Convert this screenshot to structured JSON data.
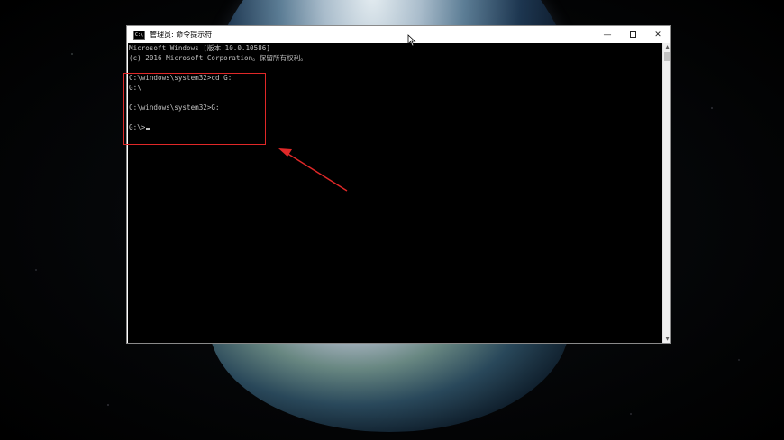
{
  "window": {
    "title": "管理员: 命令提示符",
    "icon_label": "C:\\",
    "controls": {
      "minimize": "—",
      "close": "✕"
    }
  },
  "console": {
    "lines": [
      "Microsoft Windows [版本 10.0.10586]",
      "(c) 2016 Microsoft Corporation。保留所有权利。",
      "",
      "C:\\windows\\system32>cd G:",
      "G:\\",
      "",
      "C:\\windows\\system32>G:",
      "",
      "G:\\>"
    ]
  },
  "scrollbar": {
    "up": "▲",
    "down": "▼"
  },
  "annotation": {
    "color": "#e02828"
  },
  "colors": {
    "console_bg": "#000000",
    "console_text": "#c0c0c0",
    "titlebar": "#ffffff"
  }
}
